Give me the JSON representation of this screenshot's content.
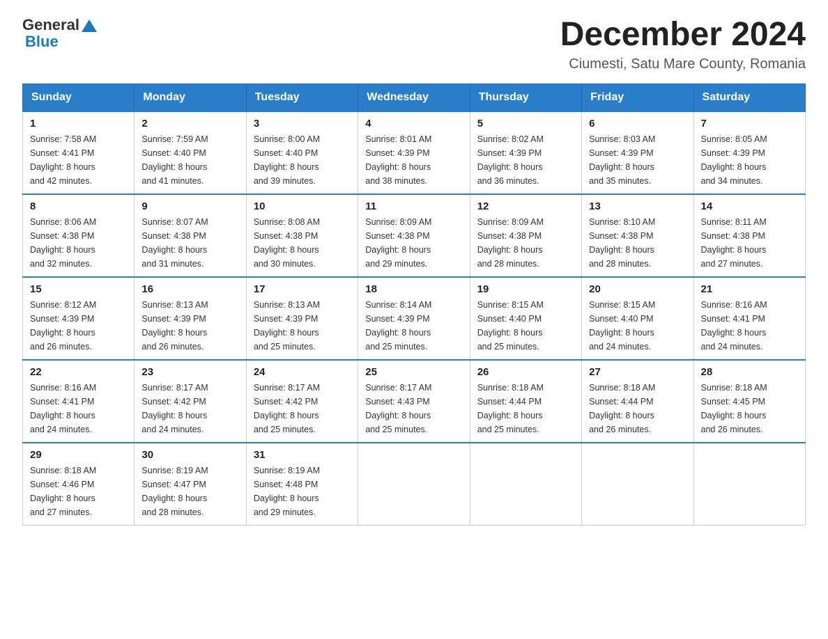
{
  "logo": {
    "text_general": "General",
    "text_blue": "Blue"
  },
  "title": "December 2024",
  "subtitle": "Ciumesti, Satu Mare County, Romania",
  "days_of_week": [
    "Sunday",
    "Monday",
    "Tuesday",
    "Wednesday",
    "Thursday",
    "Friday",
    "Saturday"
  ],
  "weeks": [
    [
      {
        "day": "1",
        "sunrise": "7:58 AM",
        "sunset": "4:41 PM",
        "daylight": "8 hours and 42 minutes."
      },
      {
        "day": "2",
        "sunrise": "7:59 AM",
        "sunset": "4:40 PM",
        "daylight": "8 hours and 41 minutes."
      },
      {
        "day": "3",
        "sunrise": "8:00 AM",
        "sunset": "4:40 PM",
        "daylight": "8 hours and 39 minutes."
      },
      {
        "day": "4",
        "sunrise": "8:01 AM",
        "sunset": "4:39 PM",
        "daylight": "8 hours and 38 minutes."
      },
      {
        "day": "5",
        "sunrise": "8:02 AM",
        "sunset": "4:39 PM",
        "daylight": "8 hours and 36 minutes."
      },
      {
        "day": "6",
        "sunrise": "8:03 AM",
        "sunset": "4:39 PM",
        "daylight": "8 hours and 35 minutes."
      },
      {
        "day": "7",
        "sunrise": "8:05 AM",
        "sunset": "4:39 PM",
        "daylight": "8 hours and 34 minutes."
      }
    ],
    [
      {
        "day": "8",
        "sunrise": "8:06 AM",
        "sunset": "4:38 PM",
        "daylight": "8 hours and 32 minutes."
      },
      {
        "day": "9",
        "sunrise": "8:07 AM",
        "sunset": "4:38 PM",
        "daylight": "8 hours and 31 minutes."
      },
      {
        "day": "10",
        "sunrise": "8:08 AM",
        "sunset": "4:38 PM",
        "daylight": "8 hours and 30 minutes."
      },
      {
        "day": "11",
        "sunrise": "8:09 AM",
        "sunset": "4:38 PM",
        "daylight": "8 hours and 29 minutes."
      },
      {
        "day": "12",
        "sunrise": "8:09 AM",
        "sunset": "4:38 PM",
        "daylight": "8 hours and 28 minutes."
      },
      {
        "day": "13",
        "sunrise": "8:10 AM",
        "sunset": "4:38 PM",
        "daylight": "8 hours and 28 minutes."
      },
      {
        "day": "14",
        "sunrise": "8:11 AM",
        "sunset": "4:38 PM",
        "daylight": "8 hours and 27 minutes."
      }
    ],
    [
      {
        "day": "15",
        "sunrise": "8:12 AM",
        "sunset": "4:39 PM",
        "daylight": "8 hours and 26 minutes."
      },
      {
        "day": "16",
        "sunrise": "8:13 AM",
        "sunset": "4:39 PM",
        "daylight": "8 hours and 26 minutes."
      },
      {
        "day": "17",
        "sunrise": "8:13 AM",
        "sunset": "4:39 PM",
        "daylight": "8 hours and 25 minutes."
      },
      {
        "day": "18",
        "sunrise": "8:14 AM",
        "sunset": "4:39 PM",
        "daylight": "8 hours and 25 minutes."
      },
      {
        "day": "19",
        "sunrise": "8:15 AM",
        "sunset": "4:40 PM",
        "daylight": "8 hours and 25 minutes."
      },
      {
        "day": "20",
        "sunrise": "8:15 AM",
        "sunset": "4:40 PM",
        "daylight": "8 hours and 24 minutes."
      },
      {
        "day": "21",
        "sunrise": "8:16 AM",
        "sunset": "4:41 PM",
        "daylight": "8 hours and 24 minutes."
      }
    ],
    [
      {
        "day": "22",
        "sunrise": "8:16 AM",
        "sunset": "4:41 PM",
        "daylight": "8 hours and 24 minutes."
      },
      {
        "day": "23",
        "sunrise": "8:17 AM",
        "sunset": "4:42 PM",
        "daylight": "8 hours and 24 minutes."
      },
      {
        "day": "24",
        "sunrise": "8:17 AM",
        "sunset": "4:42 PM",
        "daylight": "8 hours and 25 minutes."
      },
      {
        "day": "25",
        "sunrise": "8:17 AM",
        "sunset": "4:43 PM",
        "daylight": "8 hours and 25 minutes."
      },
      {
        "day": "26",
        "sunrise": "8:18 AM",
        "sunset": "4:44 PM",
        "daylight": "8 hours and 25 minutes."
      },
      {
        "day": "27",
        "sunrise": "8:18 AM",
        "sunset": "4:44 PM",
        "daylight": "8 hours and 26 minutes."
      },
      {
        "day": "28",
        "sunrise": "8:18 AM",
        "sunset": "4:45 PM",
        "daylight": "8 hours and 26 minutes."
      }
    ],
    [
      {
        "day": "29",
        "sunrise": "8:18 AM",
        "sunset": "4:46 PM",
        "daylight": "8 hours and 27 minutes."
      },
      {
        "day": "30",
        "sunrise": "8:19 AM",
        "sunset": "4:47 PM",
        "daylight": "8 hours and 28 minutes."
      },
      {
        "day": "31",
        "sunrise": "8:19 AM",
        "sunset": "4:48 PM",
        "daylight": "8 hours and 29 minutes."
      },
      null,
      null,
      null,
      null
    ]
  ],
  "labels": {
    "sunrise": "Sunrise:",
    "sunset": "Sunset:",
    "daylight": "Daylight:"
  }
}
